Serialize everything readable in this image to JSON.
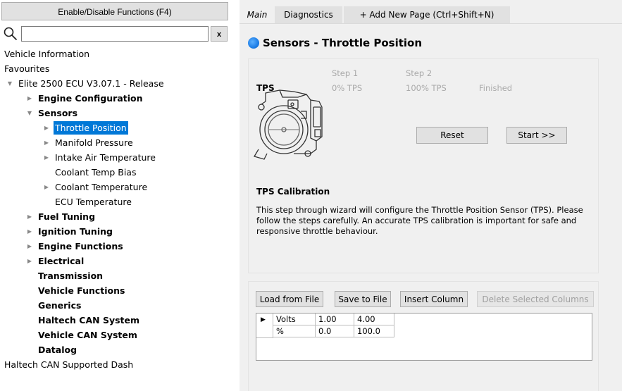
{
  "left": {
    "enable_button": "Enable/Disable Functions (F4)",
    "search_placeholder": "",
    "clear_label": "x",
    "tree": [
      {
        "label": "Vehicle Information",
        "depth": 0,
        "expander": "none",
        "bold": false,
        "selected": false
      },
      {
        "label": "Favourites",
        "depth": 0,
        "expander": "none",
        "bold": false,
        "selected": false
      },
      {
        "label": "Elite 2500 ECU V3.07.1 - Release",
        "depth": 0,
        "expander": "expanded",
        "bold": false,
        "selected": false
      },
      {
        "label": "Engine Configuration",
        "depth": 1,
        "expander": "collapsed",
        "bold": true,
        "selected": false
      },
      {
        "label": "Sensors",
        "depth": 1,
        "expander": "expanded",
        "bold": true,
        "selected": false
      },
      {
        "label": "Throttle Position",
        "depth": 2,
        "expander": "collapsed",
        "bold": false,
        "selected": true
      },
      {
        "label": "Manifold Pressure",
        "depth": 2,
        "expander": "collapsed",
        "bold": false,
        "selected": false
      },
      {
        "label": "Intake Air Temperature",
        "depth": 2,
        "expander": "collapsed",
        "bold": false,
        "selected": false
      },
      {
        "label": "Coolant Temp Bias",
        "depth": 2,
        "expander": "none",
        "bold": false,
        "selected": false
      },
      {
        "label": "Coolant Temperature",
        "depth": 2,
        "expander": "collapsed",
        "bold": false,
        "selected": false
      },
      {
        "label": "ECU Temperature",
        "depth": 2,
        "expander": "none",
        "bold": false,
        "selected": false
      },
      {
        "label": "Fuel Tuning",
        "depth": 1,
        "expander": "collapsed",
        "bold": true,
        "selected": false
      },
      {
        "label": "Ignition Tuning",
        "depth": 1,
        "expander": "collapsed",
        "bold": true,
        "selected": false
      },
      {
        "label": "Engine Functions",
        "depth": 1,
        "expander": "collapsed",
        "bold": true,
        "selected": false
      },
      {
        "label": "Electrical",
        "depth": 1,
        "expander": "collapsed",
        "bold": true,
        "selected": false
      },
      {
        "label": "Transmission",
        "depth": 1,
        "expander": "none",
        "bold": true,
        "selected": false
      },
      {
        "label": "Vehicle Functions",
        "depth": 1,
        "expander": "none",
        "bold": true,
        "selected": false
      },
      {
        "label": "Generics",
        "depth": 1,
        "expander": "none",
        "bold": true,
        "selected": false
      },
      {
        "label": "Haltech CAN System",
        "depth": 1,
        "expander": "none",
        "bold": true,
        "selected": false
      },
      {
        "label": "Vehicle CAN System",
        "depth": 1,
        "expander": "none",
        "bold": true,
        "selected": false
      },
      {
        "label": "Datalog",
        "depth": 1,
        "expander": "none",
        "bold": true,
        "selected": false
      },
      {
        "label": "Haltech CAN Supported Dash",
        "depth": 0,
        "expander": "none",
        "bold": false,
        "selected": false
      }
    ]
  },
  "tabs": [
    {
      "label": "Main",
      "active": true
    },
    {
      "label": "Diagnostics",
      "active": false
    },
    {
      "label": "+ Add New Page (Ctrl+Shift+N)",
      "active": false
    }
  ],
  "page": {
    "title": "Sensors - Throttle Position"
  },
  "wizard": {
    "sensor": "TPS",
    "step1_heading": "Step 1",
    "step1_value": "0% TPS",
    "step2_heading": "Step 2",
    "step2_value": "100% TPS",
    "finished": "Finished",
    "reset_button": "Reset",
    "start_button": "Start >>",
    "calib_title": "TPS Calibration",
    "calib_desc": "This step through wizard will configure the Throttle Position Sensor (TPS). Please follow the steps carefully. An accurate TPS calibration is important for safe and responsive throttle behaviour."
  },
  "table_panel": {
    "load_button": "Load from File",
    "save_button": "Save to File",
    "insert_button": "Insert Column",
    "delete_button": "Delete Selected Columns",
    "rows": [
      {
        "label": "Volts",
        "values": [
          "1.00",
          "4.00"
        ]
      },
      {
        "label": "%",
        "values": [
          "0.0",
          "100.0"
        ]
      }
    ]
  },
  "colors": {
    "selection": "#0078d7",
    "panel_bg": "#f0f0f0",
    "step_text": "#aaaaaa"
  }
}
